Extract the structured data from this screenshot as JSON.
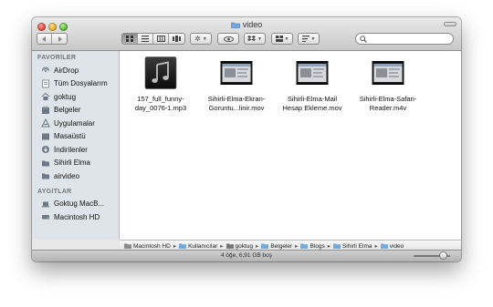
{
  "window": {
    "title": "video"
  },
  "toolbar": {
    "back_icon": "chevron-left-icon",
    "forward_icon": "chevron-right-icon",
    "view_modes": [
      "icon-view-icon",
      "list-view-icon",
      "column-view-icon",
      "coverflow-view-icon"
    ],
    "active_view": "icon-view-icon",
    "action_icon": "gear-icon",
    "quicklook_icon": "eye-icon",
    "share_icon": "dropbox-icon",
    "arrange_icon": "arrange-icon",
    "sort_icon": "sort-icon",
    "search": {
      "placeholder": "",
      "value": ""
    }
  },
  "sidebar": {
    "favorites_header": "FAVORİLER",
    "favorites": [
      {
        "label": "AirDrop",
        "icon": "airdrop-icon"
      },
      {
        "label": "Tüm Dosyalarım",
        "icon": "all-files-icon"
      },
      {
        "label": "goktug",
        "icon": "home-icon"
      },
      {
        "label": "Belgeler",
        "icon": "documents-icon"
      },
      {
        "label": "Uygulamalar",
        "icon": "applications-icon"
      },
      {
        "label": "Masaüstü",
        "icon": "desktop-icon"
      },
      {
        "label": "İndirilenler",
        "icon": "downloads-icon"
      },
      {
        "label": "Sihirli Elma",
        "icon": "folder-icon"
      },
      {
        "label": "airvideo",
        "icon": "folder-icon"
      }
    ],
    "devices_header": "AYGITLAR",
    "devices": [
      {
        "label": "Goktug MacB...",
        "icon": "laptop-icon"
      },
      {
        "label": "Macintosh HD",
        "icon": "hard-drive-icon"
      }
    ]
  },
  "files": [
    {
      "line1": "157_full_funny-",
      "line2": "day_0076-1.mp3",
      "icon": "music-file-icon"
    },
    {
      "line1": "Sihirli-Elma-Ekran-",
      "line2": "Goruntu...linir.mov",
      "icon": "movie-thumbnail-icon"
    },
    {
      "line1": "Sihirli-Elma-Mail",
      "line2": "Hesap Ekleme.mov",
      "icon": "movie-thumbnail-icon"
    },
    {
      "line1": "Sihirli-Elma-Safari-",
      "line2": "Reader.m4v",
      "icon": "movie-thumbnail-icon"
    }
  ],
  "pathbar": [
    "Macintosh HD",
    "Kullanıcılar",
    "goktug",
    "Belgeler",
    "Blogs",
    "Sihirli Elma",
    "video"
  ],
  "status": {
    "text": "4 öğe, 6,91 GB boş",
    "zoom_level": 0.8
  }
}
